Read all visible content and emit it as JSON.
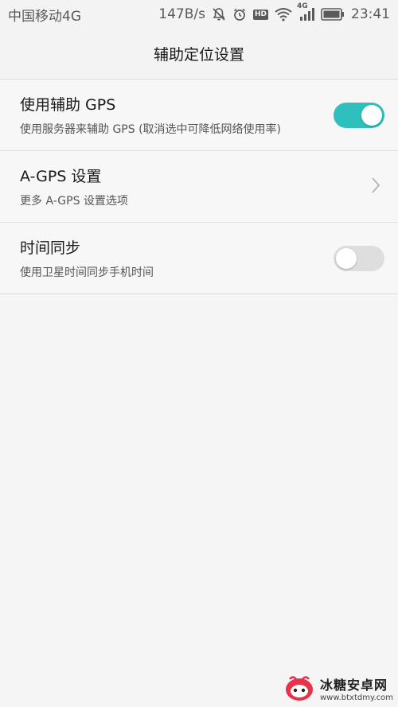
{
  "status_bar": {
    "carrier": "中国移动4G",
    "net_speed": "147B/s",
    "hd_badge": "HD",
    "network_type": "4G",
    "time": "23:41"
  },
  "header": {
    "title": "辅助定位设置"
  },
  "settings": [
    {
      "title": "使用辅助 GPS",
      "subtitle": "使用服务器来辅助 GPS (取消选中可降低网络使用率)",
      "control": "toggle",
      "enabled": true
    },
    {
      "title": "A-GPS 设置",
      "subtitle": "更多 A-GPS 设置选项",
      "control": "chevron"
    },
    {
      "title": "时间同步",
      "subtitle": "使用卫星时间同步手机时间",
      "control": "toggle",
      "enabled": false
    }
  ],
  "colors": {
    "toggle_on": "#2fc0bd",
    "toggle_off": "#dedede",
    "background": "#f5f5f5"
  },
  "watermark": {
    "name": "冰糖安卓网",
    "url": "www.btxtdmy.com"
  }
}
